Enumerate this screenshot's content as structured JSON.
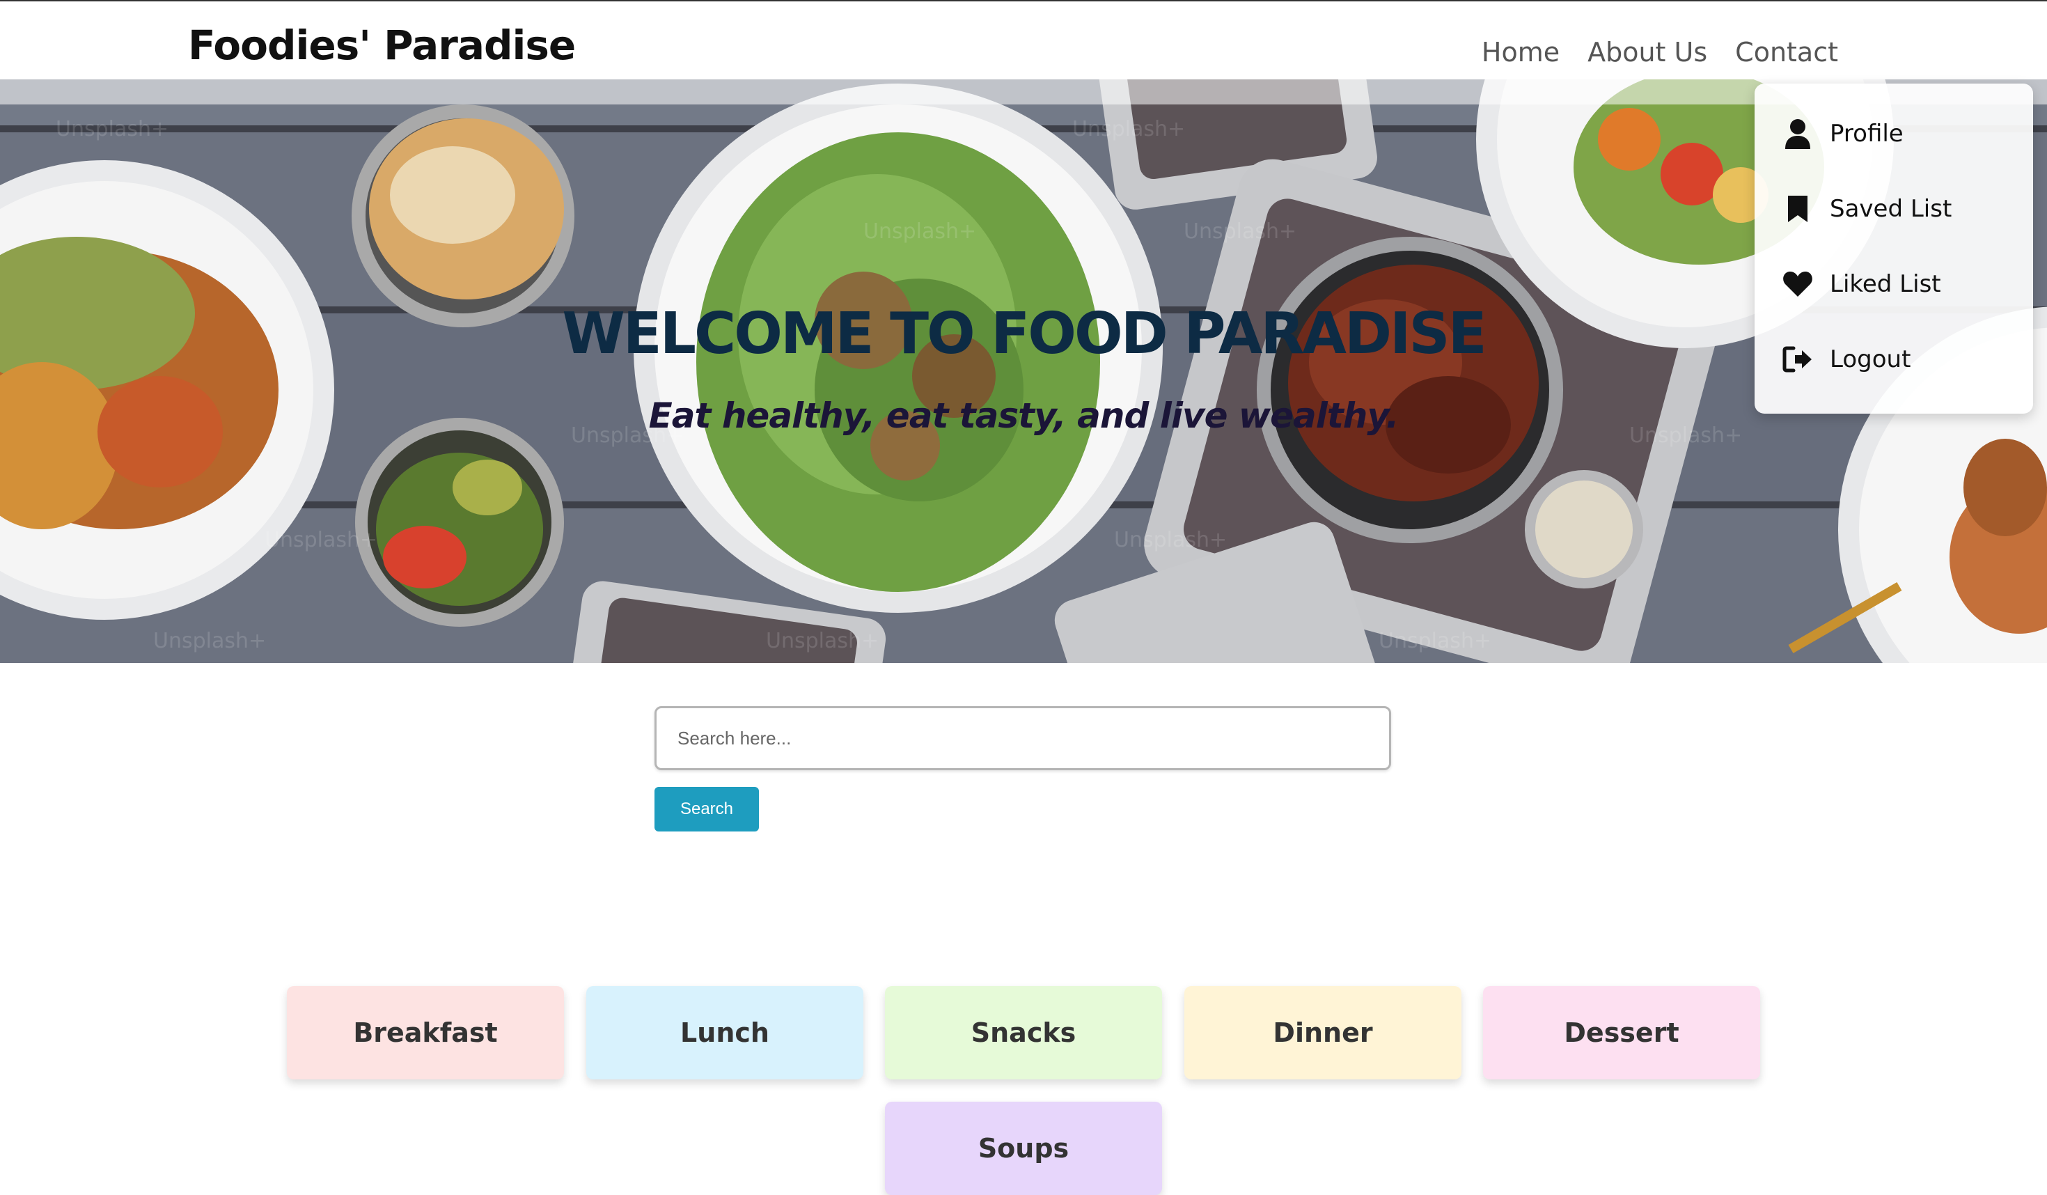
{
  "header": {
    "brand": "Foodies' Paradise",
    "nav": [
      "Home",
      "About Us",
      "Contact"
    ]
  },
  "hero": {
    "title": "WELCOME TO FOOD PARADISE",
    "subtitle": "Eat healthy, eat tasty, and live wealthy."
  },
  "dropdown": {
    "items": [
      {
        "label": "Profile",
        "icon": "user-icon"
      },
      {
        "label": "Saved List",
        "icon": "bookmark-icon"
      },
      {
        "label": "Liked List",
        "icon": "heart-icon"
      },
      {
        "label": "Logout",
        "icon": "logout-icon"
      }
    ]
  },
  "search": {
    "placeholder": "Search here...",
    "button_label": "Search"
  },
  "categories": [
    {
      "label": "Breakfast",
      "color": "#fde3e2"
    },
    {
      "label": "Lunch",
      "color": "#d8f2fd"
    },
    {
      "label": "Snacks",
      "color": "#e6fad8"
    },
    {
      "label": "Dinner",
      "color": "#fff4d6"
    },
    {
      "label": "Dessert",
      "color": "#fde0f1"
    },
    {
      "label": "Soups",
      "color": "#e7d6fb"
    }
  ],
  "colors": {
    "accent": "#1e9dbf",
    "hero_title": "#0d2b44",
    "hero_subtitle": "#1b1538"
  }
}
